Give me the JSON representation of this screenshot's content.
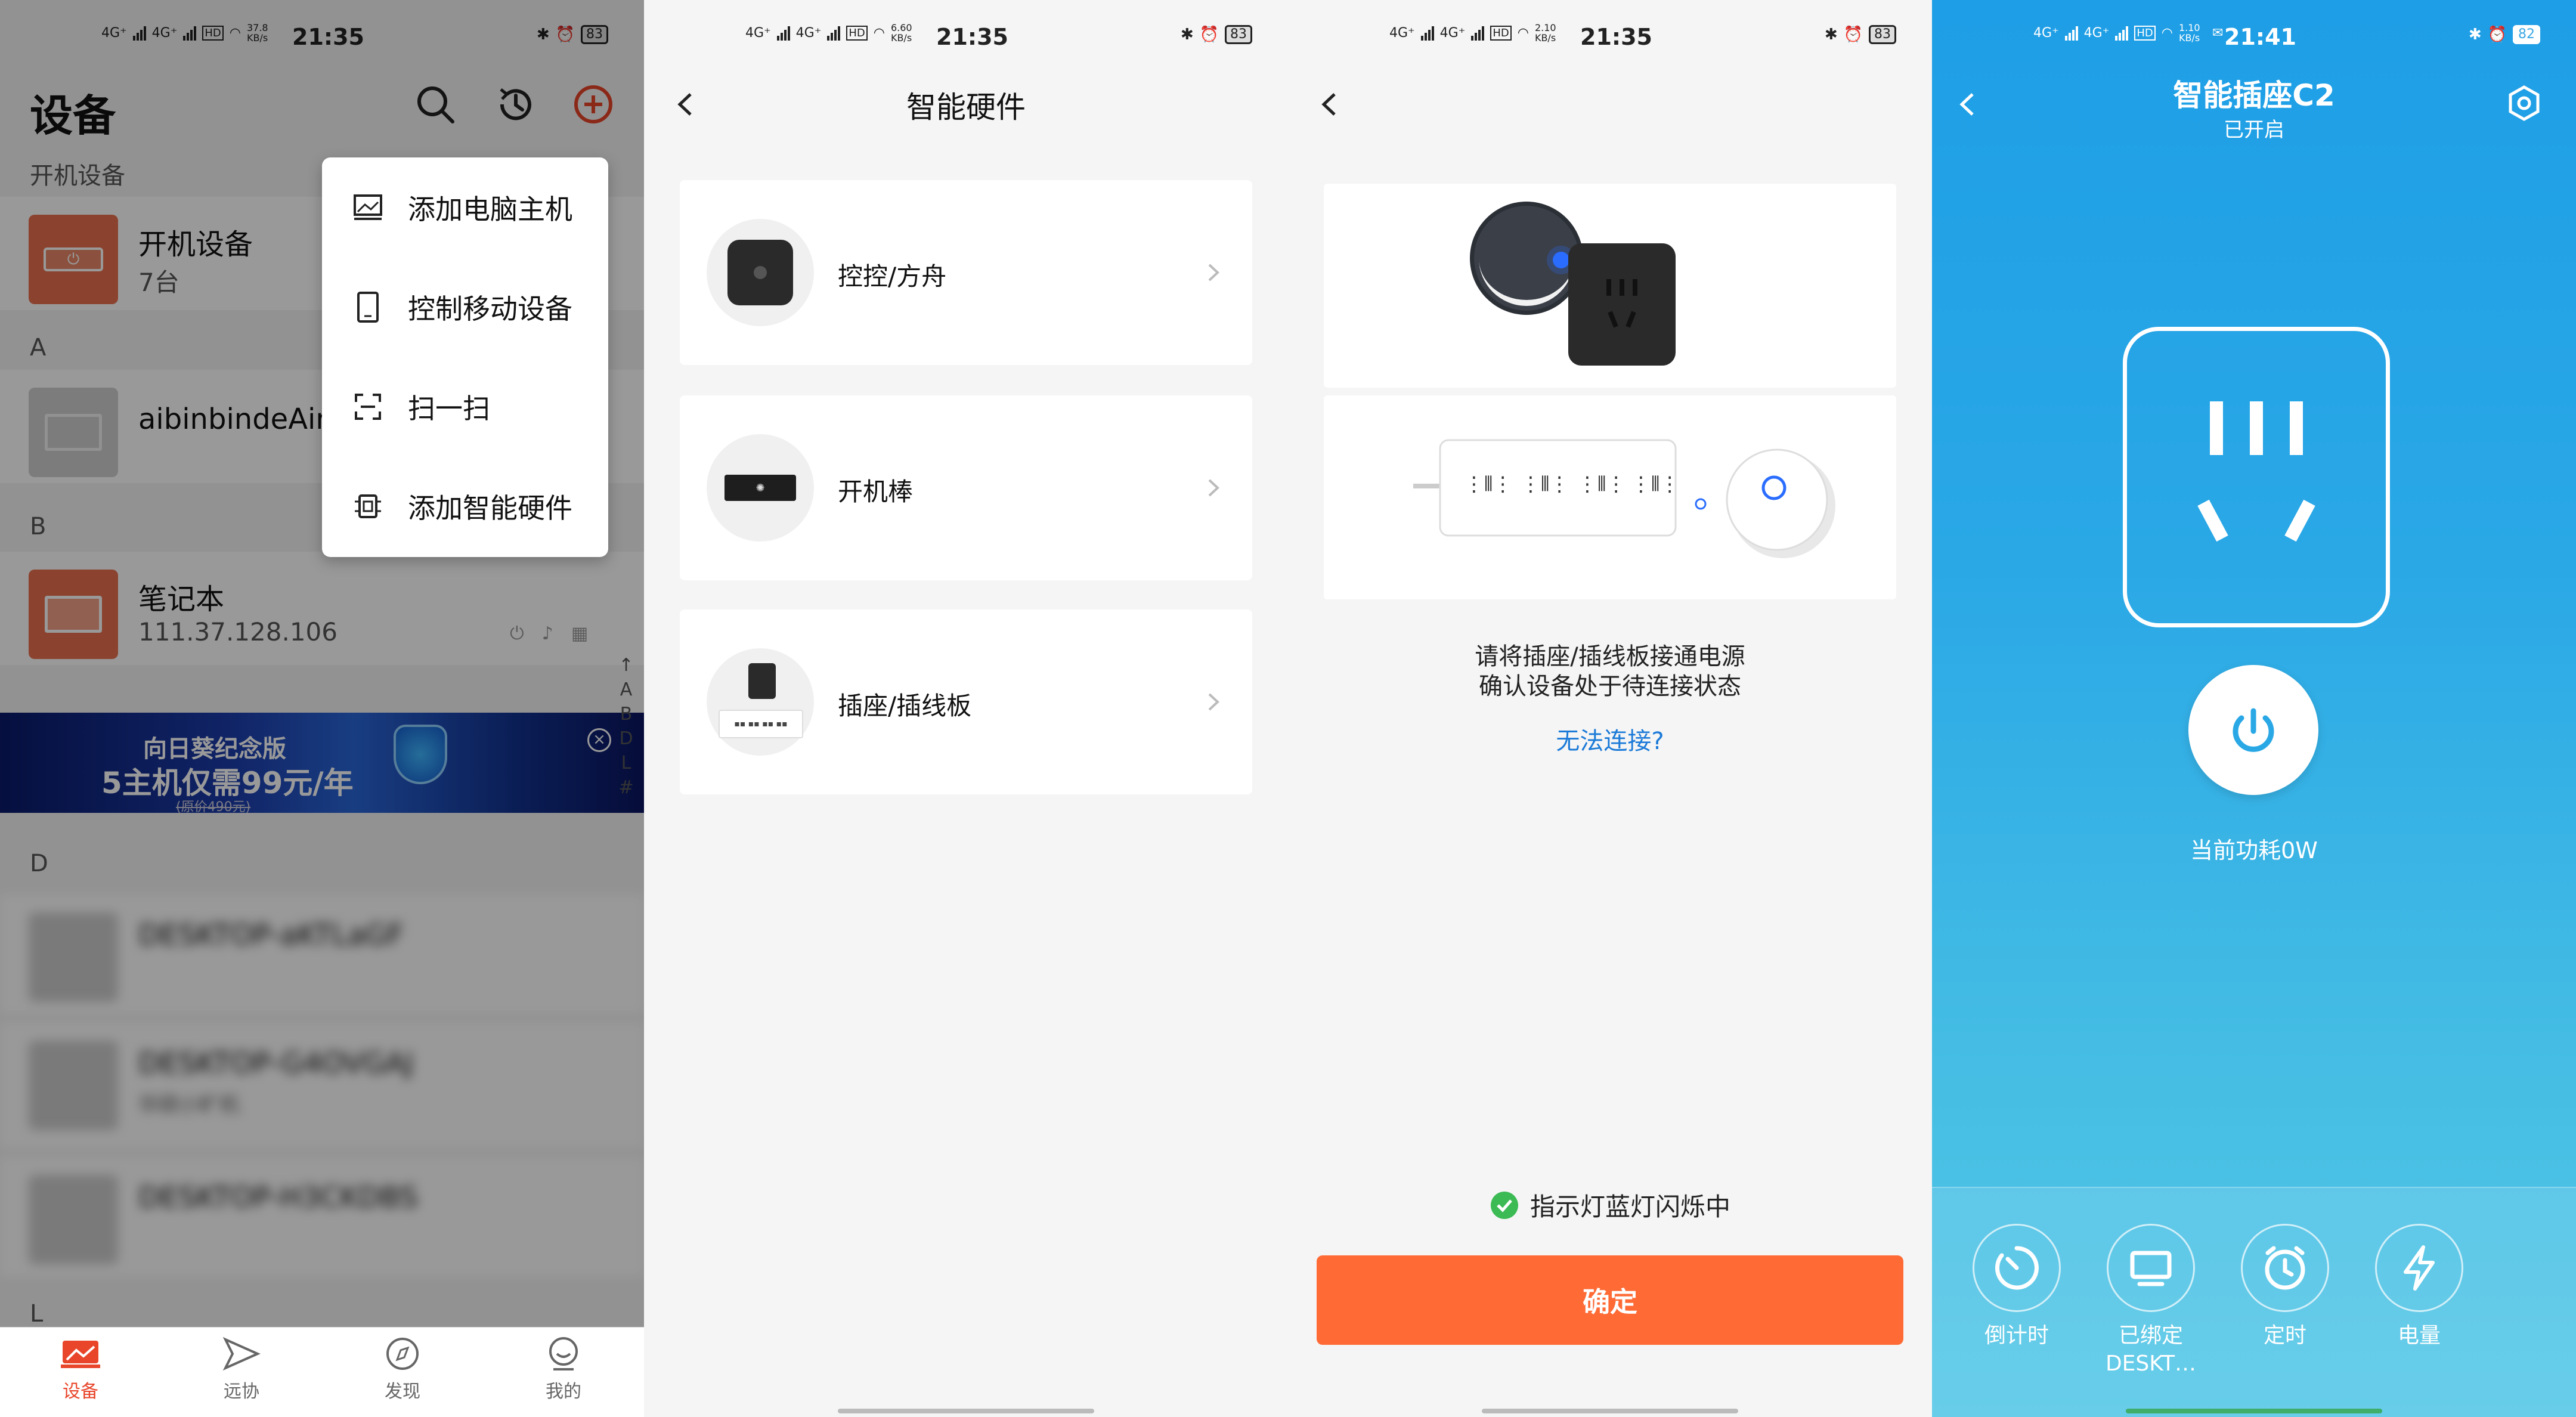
{
  "colors": {
    "accent_orange": "#ff6a35",
    "link_blue": "#1b7ad8",
    "plug_blue": "#2aa8e6",
    "success_green": "#3cba54"
  },
  "panel1": {
    "status": {
      "net1": "4G⁺",
      "net2": "4G⁺",
      "hd": "HD",
      "speed": "37.8 KB/s",
      "time": "21:35",
      "battery": "83"
    },
    "title": "设备",
    "section_on": "开机设备",
    "dev_on": {
      "name": "开机设备",
      "count": "7台"
    },
    "section_a": "A",
    "dev_a": {
      "name": "aibinbindeAir"
    },
    "section_b": "B",
    "dev_b": {
      "name": "笔记本",
      "ip": "111.37.128.106"
    },
    "ad": {
      "line1": "向日葵纪念版",
      "line2": "5主机仅需99元/年",
      "line3": "(原价490元)"
    },
    "alpha_index": [
      "↑",
      "A",
      "B",
      "D",
      "L",
      "#"
    ],
    "section_d": "D",
    "blurred": [
      {
        "name": "DESKTOP-aKTLaGF"
      },
      {
        "name": "DESKTOP-G4OVGAJ",
        "sub": "华硕小旷机"
      },
      {
        "name": "DESKTOP-H3CKDBS"
      }
    ],
    "section_l": "L",
    "menu": [
      "添加电脑主机",
      "控制移动设备",
      "扫一扫",
      "添加智能硬件"
    ],
    "tabs": [
      "设备",
      "远协",
      "发现",
      "我的"
    ]
  },
  "panel2": {
    "status": {
      "net1": "4G⁺",
      "net2": "4G⁺",
      "hd": "HD",
      "speed": "6.60 KB/s",
      "time": "21:35",
      "battery": "83"
    },
    "title": "智能硬件",
    "items": [
      "控控/方舟",
      "开机棒",
      "插座/插线板"
    ]
  },
  "panel3": {
    "status": {
      "net1": "4G⁺",
      "net2": "4G⁺",
      "hd": "HD",
      "speed": "2.10 KB/s",
      "time": "21:35",
      "battery": "83"
    },
    "line1": "请将插座/插线板接通电源",
    "line2": "确认设备处于待连接状态",
    "link": "无法连接?",
    "check": "指示灯蓝灯闪烁中",
    "confirm": "确定"
  },
  "panel4": {
    "status": {
      "net1": "4G⁺",
      "net2": "4G⁺",
      "hd": "HD",
      "speed": "1.10 KB/s",
      "time": "21:41",
      "battery": "82"
    },
    "title": "智能插座C2",
    "subtitle": "已开启",
    "power": "当前功耗0W",
    "functions": [
      {
        "label": "倒计时",
        "sub": ""
      },
      {
        "label": "已绑定",
        "sub": "DESKT…"
      },
      {
        "label": "定时",
        "sub": ""
      },
      {
        "label": "电量",
        "sub": ""
      }
    ]
  }
}
